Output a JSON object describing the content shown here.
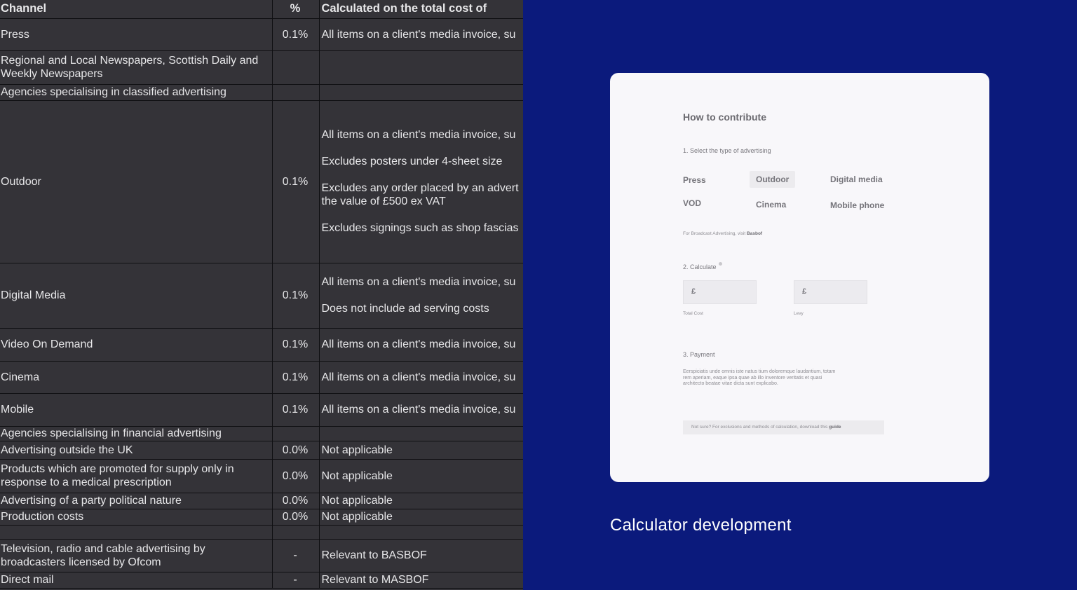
{
  "table": {
    "headers": [
      "Channel",
      "%",
      "Calculated on the total cost of"
    ],
    "rows": [
      {
        "channel": "Press",
        "pct": "0.1%",
        "notes": [
          "All items on a client's media invoice, su"
        ]
      },
      {
        "channel": "Regional and Local Newspapers, Scottish Daily and Weekly Newspapers",
        "pct": "",
        "notes": []
      },
      {
        "channel": "Agencies specialising in classified advertising",
        "pct": "",
        "notes": []
      },
      {
        "channel": "Outdoor",
        "pct": "0.1%",
        "notes": [
          "All items on a client's media invoice, su",
          "Excludes posters under 4-sheet size",
          "Excludes any order placed by an advert the value of £500 ex VAT",
          "Excludes signings such as shop fascias"
        ]
      },
      {
        "channel": "Digital Media",
        "pct": "0.1%",
        "notes": [
          "All items on a client's media invoice, su",
          "Does not include ad serving costs"
        ]
      },
      {
        "channel": "Video On Demand",
        "pct": "0.1%",
        "notes": [
          "All items on a client's media invoice, su"
        ]
      },
      {
        "channel": "Cinema",
        "pct": "0.1%",
        "notes": [
          "All items on a client's media invoice, su"
        ]
      },
      {
        "channel": "Mobile",
        "pct": "0.1%",
        "notes": [
          "All items on a client's media invoice, su"
        ]
      },
      {
        "channel": "Agencies specialising in financial advertising",
        "pct": "",
        "notes": []
      },
      {
        "channel": "Advertising outside the UK",
        "pct": "0.0%",
        "notes": [
          "Not applicable"
        ]
      },
      {
        "channel": "Products which are promoted for supply only in response to a medical prescription",
        "pct": "0.0%",
        "notes": [
          "Not applicable"
        ]
      },
      {
        "channel": "Advertising of a party political nature",
        "pct": "0.0%",
        "notes": [
          "Not applicable"
        ]
      },
      {
        "channel": "Production costs",
        "pct": "0.0%",
        "notes": [
          "Not applicable"
        ]
      },
      {
        "channel": "",
        "pct": "",
        "notes": []
      },
      {
        "channel": "Television, radio and cable advertising by broadcasters licensed by Ofcom",
        "pct": "-",
        "notes": [
          "Relevant to BASBOF"
        ]
      },
      {
        "channel": "Direct mail",
        "pct": "-",
        "notes": [
          "Relevant to MASBOF"
        ]
      }
    ]
  },
  "card": {
    "title": "How to contribute",
    "step1": "1. Select the type of advertising",
    "types": [
      "Press",
      "Outdoor",
      "Digital media",
      "VOD",
      "Cinema",
      "Mobile phone"
    ],
    "selected_type": "Outdoor",
    "broadcast_note": "For Broadcast Advertising, visit",
    "broadcast_link": "Basbof",
    "step2": "2. Calculate",
    "total_cost_prefix": "£",
    "total_cost_label": "Total Cost",
    "levy_prefix": "£",
    "levy_label": "Levy",
    "step3": "3. Payment",
    "payment_text": "Eerspiciatis unde omnis iste natus tium doloremque laudantium, totam rem aperiam, eaque ipsa quae ab illo inventore veritatis et quasi architecto beatae vitae dicta sunt explicabo.",
    "guide_text": "Not sure? For exclusions and methods of calculation, download this",
    "guide_link": "guide"
  },
  "caption": "Calculator development",
  "colors": {
    "panel_bg": "#0b1a7c",
    "sheet_bg": "#343338",
    "card_bg": "#f8f7fa"
  }
}
